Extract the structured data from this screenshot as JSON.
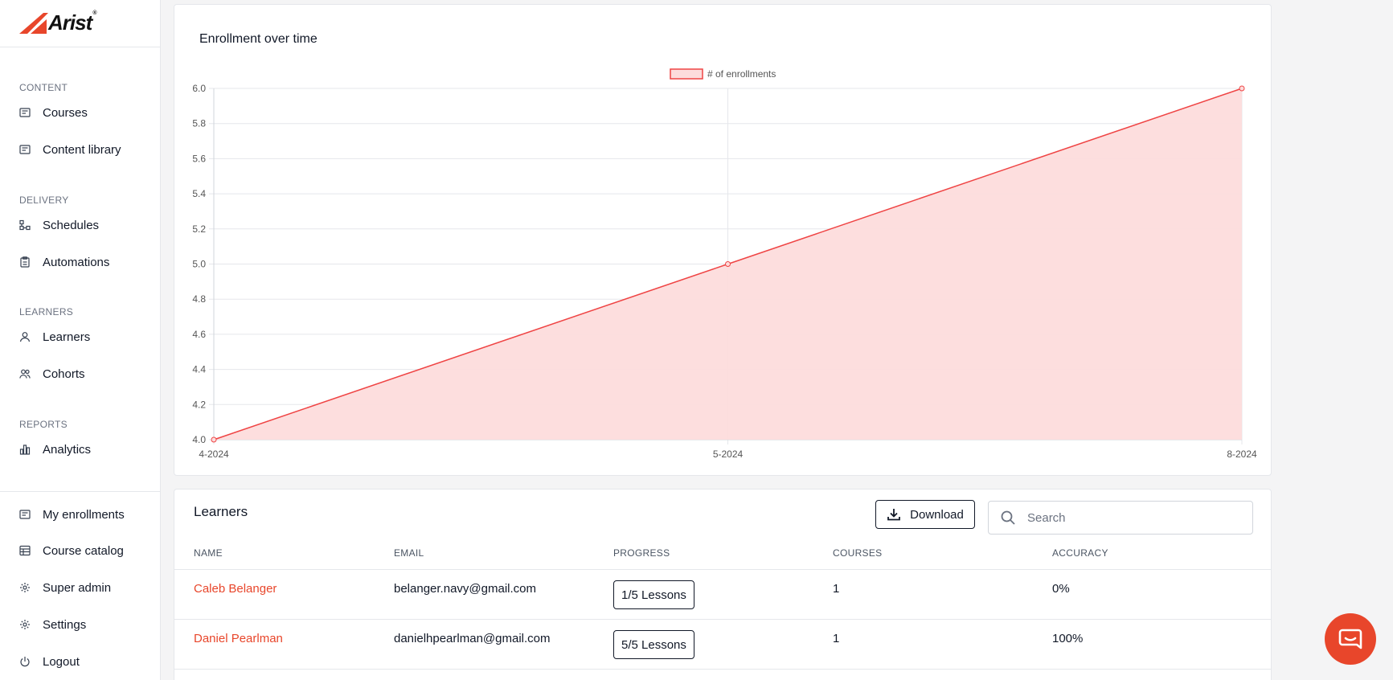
{
  "brand": {
    "name": "Arist",
    "mark": "®",
    "accent_color": "#e8462b"
  },
  "sidebar": {
    "sections": {
      "content": "CONTENT",
      "delivery": "DELIVERY",
      "learners": "LEARNERS",
      "reports": "REPORTS"
    },
    "items": {
      "courses": "Courses",
      "content_library": "Content library",
      "schedules": "Schedules",
      "automations": "Automations",
      "learners": "Learners",
      "cohorts": "Cohorts",
      "analytics": "Analytics",
      "my_enrollments": "My enrollments",
      "course_catalog": "Course catalog",
      "super_admin": "Super admin",
      "settings": "Settings",
      "logout": "Logout"
    }
  },
  "chart_card": {
    "title": "Enrollment over time"
  },
  "chart_data": {
    "type": "area",
    "categories": [
      "4-2024",
      "5-2024",
      "8-2024"
    ],
    "series": [
      {
        "name": "# of enrollments",
        "values": [
          4,
          5,
          6
        ],
        "color": "#ef4444",
        "fill": "#fddcdc"
      }
    ],
    "ylim": [
      4.0,
      6.0
    ],
    "yticks": [
      "4.0",
      "4.2",
      "4.4",
      "4.6",
      "4.8",
      "5.0",
      "5.2",
      "5.4",
      "5.6",
      "5.8",
      "6.0"
    ],
    "grid": true,
    "legend": "top-center"
  },
  "learners": {
    "title": "Learners",
    "download_label": "Download",
    "search_placeholder": "Search",
    "columns": [
      "NAME",
      "EMAIL",
      "PROGRESS",
      "COURSES",
      "ACCURACY"
    ],
    "rows": [
      {
        "name": "Caleb Belanger",
        "email": "belanger.navy@gmail.com",
        "progress": "1/5 Lessons",
        "courses": "1",
        "accuracy": "0%"
      },
      {
        "name": "Daniel Pearlman",
        "email": "danielhpearlman@gmail.com",
        "progress": "5/5 Lessons",
        "courses": "1",
        "accuracy": "100%"
      }
    ]
  }
}
